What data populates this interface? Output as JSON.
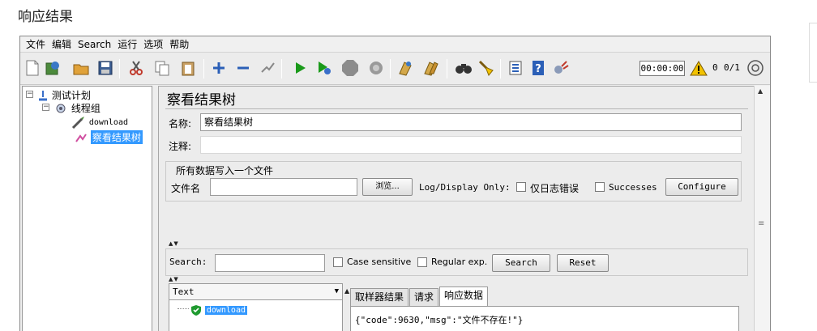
{
  "page": {
    "heading": "响应结果"
  },
  "menu": [
    "文件",
    "编辑",
    "Search",
    "运行",
    "选项",
    "帮助"
  ],
  "toolbar": {
    "timer": "00:00:00",
    "warning_count": "0",
    "thread_count": "0/1"
  },
  "tree": {
    "test_plan": "测试计划",
    "thread_group": "线程组",
    "sampler": "download",
    "listener": "察看结果树"
  },
  "panel": {
    "title": "察看结果树",
    "name_label": "名称:",
    "name_value": "察看结果树",
    "comment_label": "注释:",
    "comment_value": "",
    "file_section_title": "所有数据写入一个文件",
    "filename_label": "文件名",
    "filename_value": "",
    "browse_button": "浏览...",
    "log_display_label": "Log/Display Only:",
    "errors_only_label": "仅日志错误",
    "successes_label": "Successes",
    "configure_button": "Configure"
  },
  "search": {
    "label": "Search:",
    "value": "",
    "case_sensitive_label": "Case sensitive",
    "regex_label": "Regular exp.",
    "search_button": "Search",
    "reset_button": "Reset"
  },
  "results": {
    "renderer": "Text",
    "items": [
      "download"
    ],
    "tabs": [
      "取样器结果",
      "请求",
      "响应数据"
    ],
    "active_tab": "响应数据",
    "response_body": "{\"code\":9630,\"msg\":\"文件不存在!\"}"
  },
  "colors": {
    "selection": "#3399ff",
    "run_green": "#1a9a1a",
    "stop_gray": "#8c8c8c",
    "warning_yellow": "#f2c200"
  }
}
